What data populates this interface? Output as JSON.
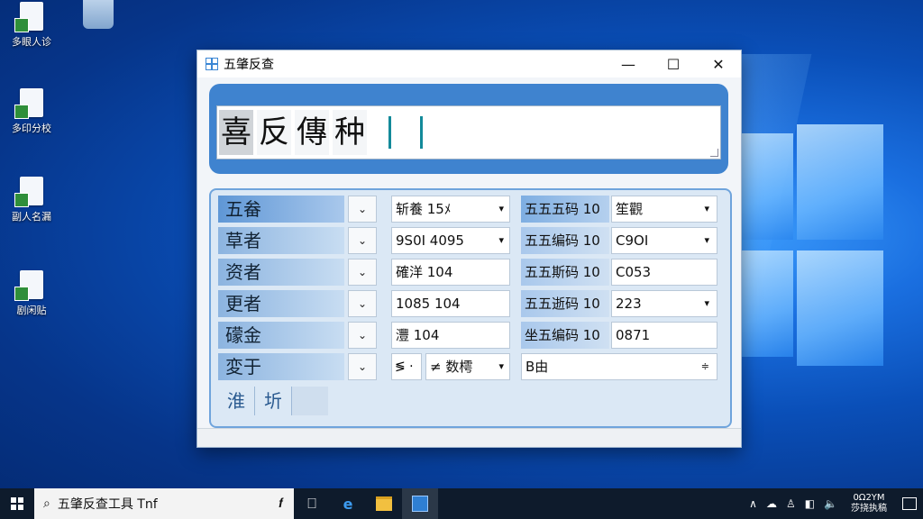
{
  "desktop": {
    "icons": [
      {
        "label": "多眼人诊"
      },
      {
        "label": "多印分校"
      },
      {
        "label": "副人名漏"
      },
      {
        "label": "剧闲贴"
      }
    ]
  },
  "window": {
    "title": "五肇反查",
    "minimize": "—",
    "maximize": "☐",
    "close": "✕"
  },
  "input": {
    "chars": [
      "喜",
      "反",
      "傳",
      "种"
    ]
  },
  "form": {
    "rows": [
      {
        "label": "五畚",
        "dd": "⌄",
        "mid": "斩養 15ﾒ",
        "mid_arrow": "▾",
        "rlabel": "五五五码 10",
        "rvalue": "笙觀",
        "r_arrow": "▾"
      },
      {
        "label": "草者",
        "dd": "⌄",
        "mid": "9S0I 4095",
        "mid_arrow": "▾",
        "rlabel": "五五编码 10",
        "rvalue": "C9OI",
        "r_arrow": "▾"
      },
      {
        "label": "资者",
        "dd": "⌄",
        "mid": "確洋 104",
        "mid_arrow": "",
        "rlabel": "五五斯码 10",
        "rvalue": "C053",
        "r_arrow": ""
      },
      {
        "label": "更者",
        "dd": "⌄",
        "mid": "1085 104",
        "mid_arrow": "",
        "rlabel": "五五逝码 10",
        "rvalue": "223",
        "r_arrow": "▾"
      },
      {
        "label": "礞金",
        "dd": "⌄",
        "mid": "灃    104",
        "mid_arrow": "",
        "rlabel": "坐五编码 10",
        "rvalue": "0871",
        "r_arrow": ""
      }
    ],
    "last_row": {
      "label": "変于",
      "dd": "⌄",
      "small": "≶ ·",
      "mid": "≠ 数樗",
      "mid_arrow": "▾",
      "rvalue": "B由",
      "r_arrow": "≑"
    },
    "tabs": [
      "淮",
      "圻"
    ]
  },
  "taskbar": {
    "search_text": "五肇反查工具 Tnf",
    "search_icon": "⌕",
    "mic_icon": "𝒇",
    "tray": [
      "∧",
      "☁",
      "♙",
      "◧",
      "🔈"
    ],
    "clock_line1": "0Ω2YM",
    "clock_line2": "莎挠执稿",
    "task_view": "⎕"
  }
}
